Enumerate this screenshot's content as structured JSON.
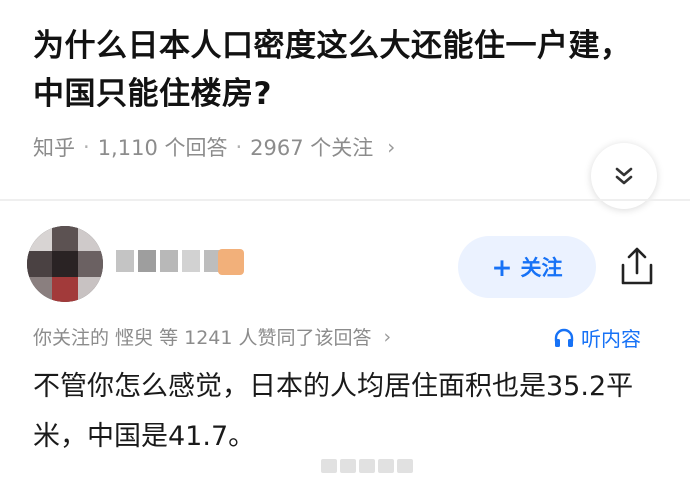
{
  "question": {
    "title": "为什么日本人口密度这么大还能住一户建，中国只能住楼房?"
  },
  "meta": {
    "source": "知乎",
    "separator": "·",
    "answers": "1,110 个回答",
    "followers": "2967 个关注",
    "chevron": "›"
  },
  "answer": {
    "follow_label": "关注",
    "follow_plus": "+",
    "liked_by": "你关注的 悭臾 等 1241 人赞同了该回答",
    "liked_chevron": "›",
    "listen_label": "听内容",
    "text": "不管你怎么感觉，日本的人均居住面积也是35.2平米，中国是41.7。"
  },
  "colors": {
    "accent": "#1772f6",
    "follow_bg": "#ebf2ff",
    "muted": "#8c8c8c"
  },
  "icons": {
    "collapse": "double-chevron-down-icon",
    "share": "share-icon",
    "listen": "headphones-icon"
  }
}
